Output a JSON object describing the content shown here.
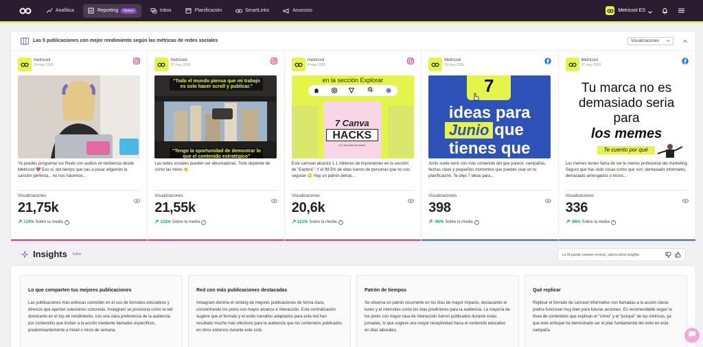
{
  "nav": {
    "items": [
      {
        "label": "Analítica",
        "icon": "chart-icon"
      },
      {
        "label": "Reporting",
        "icon": "report-icon",
        "badge": "Nuevo"
      },
      {
        "label": "Inbox",
        "icon": "inbox-icon"
      },
      {
        "label": "Planificación",
        "icon": "calendar-icon"
      },
      {
        "label": "SmartLinks",
        "icon": "link-icon"
      },
      {
        "label": "Anuncios",
        "icon": "megaphone-icon"
      }
    ],
    "account_name": "Metricool ES"
  },
  "top_posts": {
    "title": "Las 5 publicaciones con mejor rendimiento según las métricas de redes sociales",
    "metric_select": "Visualizaciones",
    "metric_label": "Visualizaciones",
    "compare_suffix": "Sobre la media",
    "posts": [
      {
        "account": "metricool",
        "date": "29 may 2026",
        "network": "instagram",
        "caption": "Ya puedes programar tus Reels con audios en tendencia desde Metricool 🤎 Eso sí, del tiempo que vas a pasar eligiendo la canción perfecta... no nos hacemos...",
        "value": "21,75k",
        "pct": "134%",
        "dir": "up"
      },
      {
        "account": "metricool",
        "date": "27 may 2026",
        "network": "instagram",
        "caption": "Las redes sociales pueden ser abrumadoras. Todo depende de cómo las mires 👏",
        "value": "21,55k",
        "pct": "132%",
        "dir": "up",
        "image_text_top": "“Todo el mundo piensa que mi trabajo es solo hacer scroll y publicar.”",
        "image_text_bottom": "“Tengo la oportunidad de demostrar lo que el contenido estratégico”"
      },
      {
        "account": "metricool",
        "date": "4 may 2026",
        "network": "instagram",
        "caption": "Este carrusel alcanzó 1.1 millones de impresiones en la sección de \"Explora\". Y el 99.5% de ellas fueron de personas que no nos seguían 😳 Hay un patrón detrás...",
        "value": "20,6k",
        "pct": "121%",
        "dir": "up",
        "image_text_top": "en la sección Explorar",
        "image_text_hacks_1": "7 Canva",
        "image_text_hacks_2": "HACKS",
        "image_text_hacks_3": "(¡Y muy fácil de usar!)"
      },
      {
        "account": "Metricool",
        "date": "29 may 2026",
        "network": "facebook",
        "caption": "Junio suele venir con más contenido del que parece: campañas, fechas clave y pequeños momentos que puedes usar en tu planificación. Te dejo 7 ideas para...",
        "value": "398",
        "pct": "-96%",
        "dir": "down",
        "image_text_1": "7",
        "image_text_2": "ideas para",
        "image_text_3": "Junio",
        "image_text_4": "que",
        "image_text_5": "tienes que"
      },
      {
        "account": "Metricool",
        "date": "27 may 2026",
        "network": "facebook",
        "caption": "Los memes tienen fama de ser lo menos profesional del marketing. Seguro que has oído cosas como que son: demasiado informales, demasiado arriesgados o inclus...",
        "value": "336",
        "pct": "-96%",
        "dir": "down",
        "image_text_1": "Tu marca no es demasiado seria para",
        "image_text_2": "los memes",
        "image_text_3": "Te cuento por qué"
      }
    ]
  },
  "insights": {
    "title": "Insights",
    "edit_label": "Editar",
    "feedback_text": "La IA puede cometer errores, valora estos insights:",
    "cards": [
      {
        "title": "Lo que comparten tus mejores publicaciones",
        "text": "Las publicaciones más exitosas coinciden en el uso de formatos educativos y directos que aportan soluciones concretas. Instagram se posiciona como la red dominante en el top de rendimiento, con una clara preferencia de la audiencia por contenidos que invitan a la acción mediante llamados específicos, predominantemente a mitad o inicio de semana."
      },
      {
        "title": "Red con más publicaciones destacadas",
        "text": "Instagram domina el ranking de mejores publicaciones de forma clara, concentrando los posts con mayor alcance e interacción. Esta centralización sugiere que el formato y el estilo narrativo adaptados para esta red han resultado mucho más efectivos para la audiencia que los contenidos publicados en otros entornos durante este ciclo."
      },
      {
        "title": "Patrón de tiempos",
        "text": "Se observa un patrón recurrente en los días de mayor impacto, destacando el lunes y el miércoles como los días predictores para la audiencia. La mayoría de los posts con mayor tasa de interacción fueron publicados durante estas jornadas, lo que sugiere una mayor receptividad hacia el contenido educativo en días laborales."
      },
      {
        "title": "Qué replicar",
        "text": "Replicar el formato de carrusel informativo con llamadas a la acción claras podría funcionar muy bien para futuras acciones. Es recomendable seguir la línea de contenidos que explican el \"cómo\" y el \"porqué\" de las métricas, ya que este enfoque ha demostrado ser el pilar fundamental del éxito en esta campaña."
      }
    ]
  },
  "colors": {
    "topbar": "#2b1d2f",
    "accent_yellow": "#e4f44a",
    "instagram_line": "#e8307a",
    "facebook_line": "#3b64d8",
    "up_green": "#1aa35a"
  }
}
